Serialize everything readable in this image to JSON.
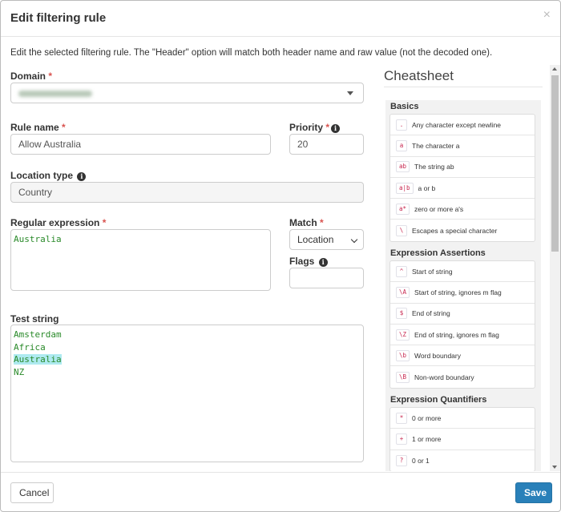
{
  "modal": {
    "title": "Edit filtering rule",
    "close_glyph": "×",
    "intro": "Edit the selected filtering rule. The \"Header\" option will match both header name and raw value (not the decoded one)."
  },
  "form": {
    "required_mark": "*",
    "domain": {
      "label": "Domain"
    },
    "rule_name": {
      "label": "Rule name",
      "value": "Allow Australia"
    },
    "priority": {
      "label": "Priority",
      "value": "20"
    },
    "location_type": {
      "label": "Location type",
      "value": "Country"
    },
    "regex": {
      "label": "Regular expression",
      "value": "Australia"
    },
    "match": {
      "label": "Match",
      "value": "Location"
    },
    "flags": {
      "label": "Flags",
      "value": ""
    },
    "test_string": {
      "label": "Test string",
      "lines": [
        "Amsterdam",
        "Africa",
        "Australia",
        "NZ"
      ],
      "highlighted_line": 2
    }
  },
  "cheatsheet": {
    "title": "Cheatsheet",
    "sections": [
      {
        "title": "Basics",
        "items": [
          {
            "code": ".",
            "desc": "Any character except newline"
          },
          {
            "code": "a",
            "desc": "The character a"
          },
          {
            "code": "ab",
            "desc": "The string ab"
          },
          {
            "code": "a|b",
            "desc": "a or b"
          },
          {
            "code": "a*",
            "desc": "zero or more a's"
          },
          {
            "code": "\\",
            "desc": "Escapes a special character"
          }
        ]
      },
      {
        "title": "Expression Assertions",
        "items": [
          {
            "code": "^",
            "desc": "Start of string"
          },
          {
            "code": "\\A",
            "desc": "Start of string, ignores m flag"
          },
          {
            "code": "$",
            "desc": "End of string"
          },
          {
            "code": "\\Z",
            "desc": "End of string, ignores m flag"
          },
          {
            "code": "\\b",
            "desc": "Word boundary"
          },
          {
            "code": "\\B",
            "desc": "Non-word boundary"
          }
        ]
      },
      {
        "title": "Expression Quantifiers",
        "items": [
          {
            "code": "*",
            "desc": "0 or more"
          },
          {
            "code": "+",
            "desc": "1 or more"
          },
          {
            "code": "?",
            "desc": "0 or 1"
          }
        ]
      }
    ]
  },
  "footer": {
    "cancel_label": "Cancel",
    "save_label": "Save"
  },
  "colors": {
    "primary": "#2980b9",
    "required": "#d9534f",
    "regex_text": "#2a8a2a",
    "match_highlight": "#aeeaf0",
    "code_text": "#c7254e"
  },
  "icons": {
    "info": "info-circle-icon",
    "close": "close-icon",
    "dropdown": "caret-down-icon",
    "select": "chevron-down-icon"
  }
}
